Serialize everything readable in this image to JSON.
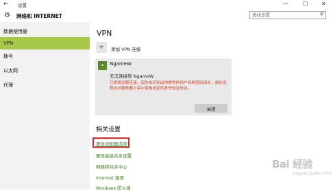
{
  "window": {
    "title": "设置",
    "min": "—",
    "max": "☐",
    "close": "✕"
  },
  "header": {
    "title": "网络和 INTERNET",
    "search_placeholder": "查找设置"
  },
  "sidebar": {
    "items": [
      {
        "label": "数据使用量",
        "active": false
      },
      {
        "label": "VPN",
        "active": true
      },
      {
        "label": "拨号",
        "active": false
      },
      {
        "label": "以太网",
        "active": false
      },
      {
        "label": "代理",
        "active": false
      }
    ]
  },
  "main": {
    "heading": "VPN",
    "add_vpn_label": "添加 VPN 连接",
    "vpn_connection": {
      "name": "NgameW",
      "status": "无法连接到 NgameW",
      "error": "已拒绝远程连接，因为未识别出你提供的用户名和密码组合，或在远程访问服务器上禁止使用选定的身份验证协议。",
      "close_label": "关闭"
    },
    "related_heading": "相关设置",
    "links": [
      "更改适配器选项",
      "更改高级共享设置",
      "网络和共享中心",
      "Internet 选项",
      "Windows 防火墙"
    ]
  },
  "watermark": {
    "text": "Bai 经验",
    "sub": "jingyan.baidu.com"
  },
  "colors": {
    "accent": "#a8c84a",
    "link": "#3a7d1c",
    "error": "#d9381e",
    "highlight": "#e0282c"
  }
}
